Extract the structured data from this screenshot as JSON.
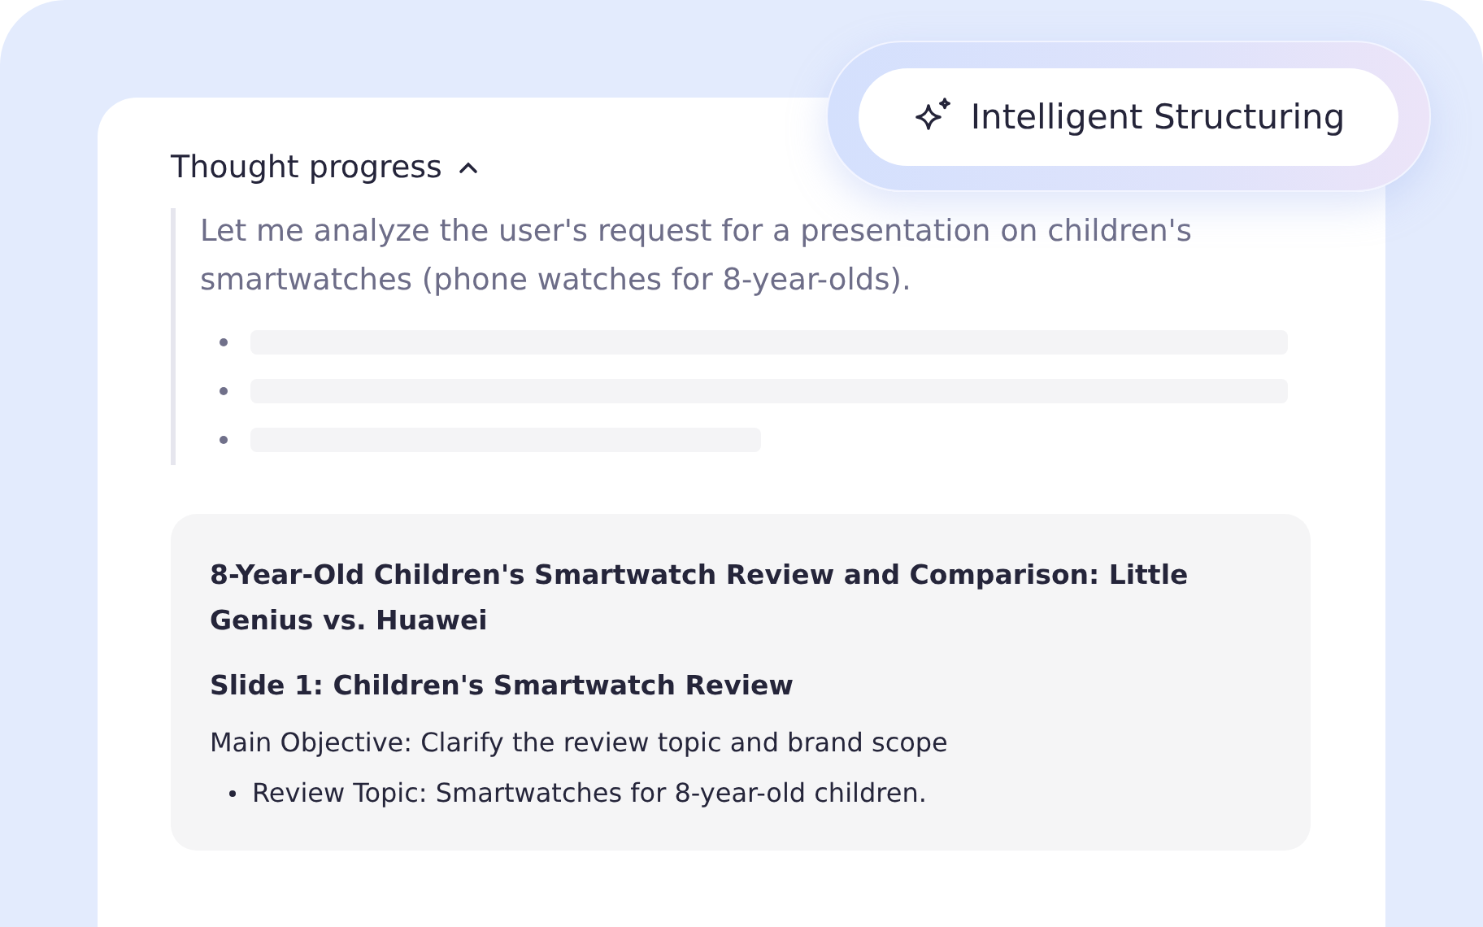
{
  "badge": {
    "label": "Intelligent Structuring"
  },
  "thought": {
    "title": "Thought progress",
    "expanded": true,
    "text": "Let me analyze the user's request for a presentation on children's smartwatches (phone watches for 8-year-olds).",
    "placeholder_lines": [
      {
        "kind": "full"
      },
      {
        "kind": "full"
      },
      {
        "kind": "short"
      }
    ]
  },
  "outline": {
    "title": "8-Year-Old Children's Smartwatch Review and Comparison: Little Genius vs. Huawei",
    "slide_title": "Slide 1: Children's Smartwatch Review",
    "objective": "Main Objective: Clarify the review topic and brand scope",
    "bullets": [
      "Review Topic: Smartwatches for 8-year-old children."
    ]
  }
}
